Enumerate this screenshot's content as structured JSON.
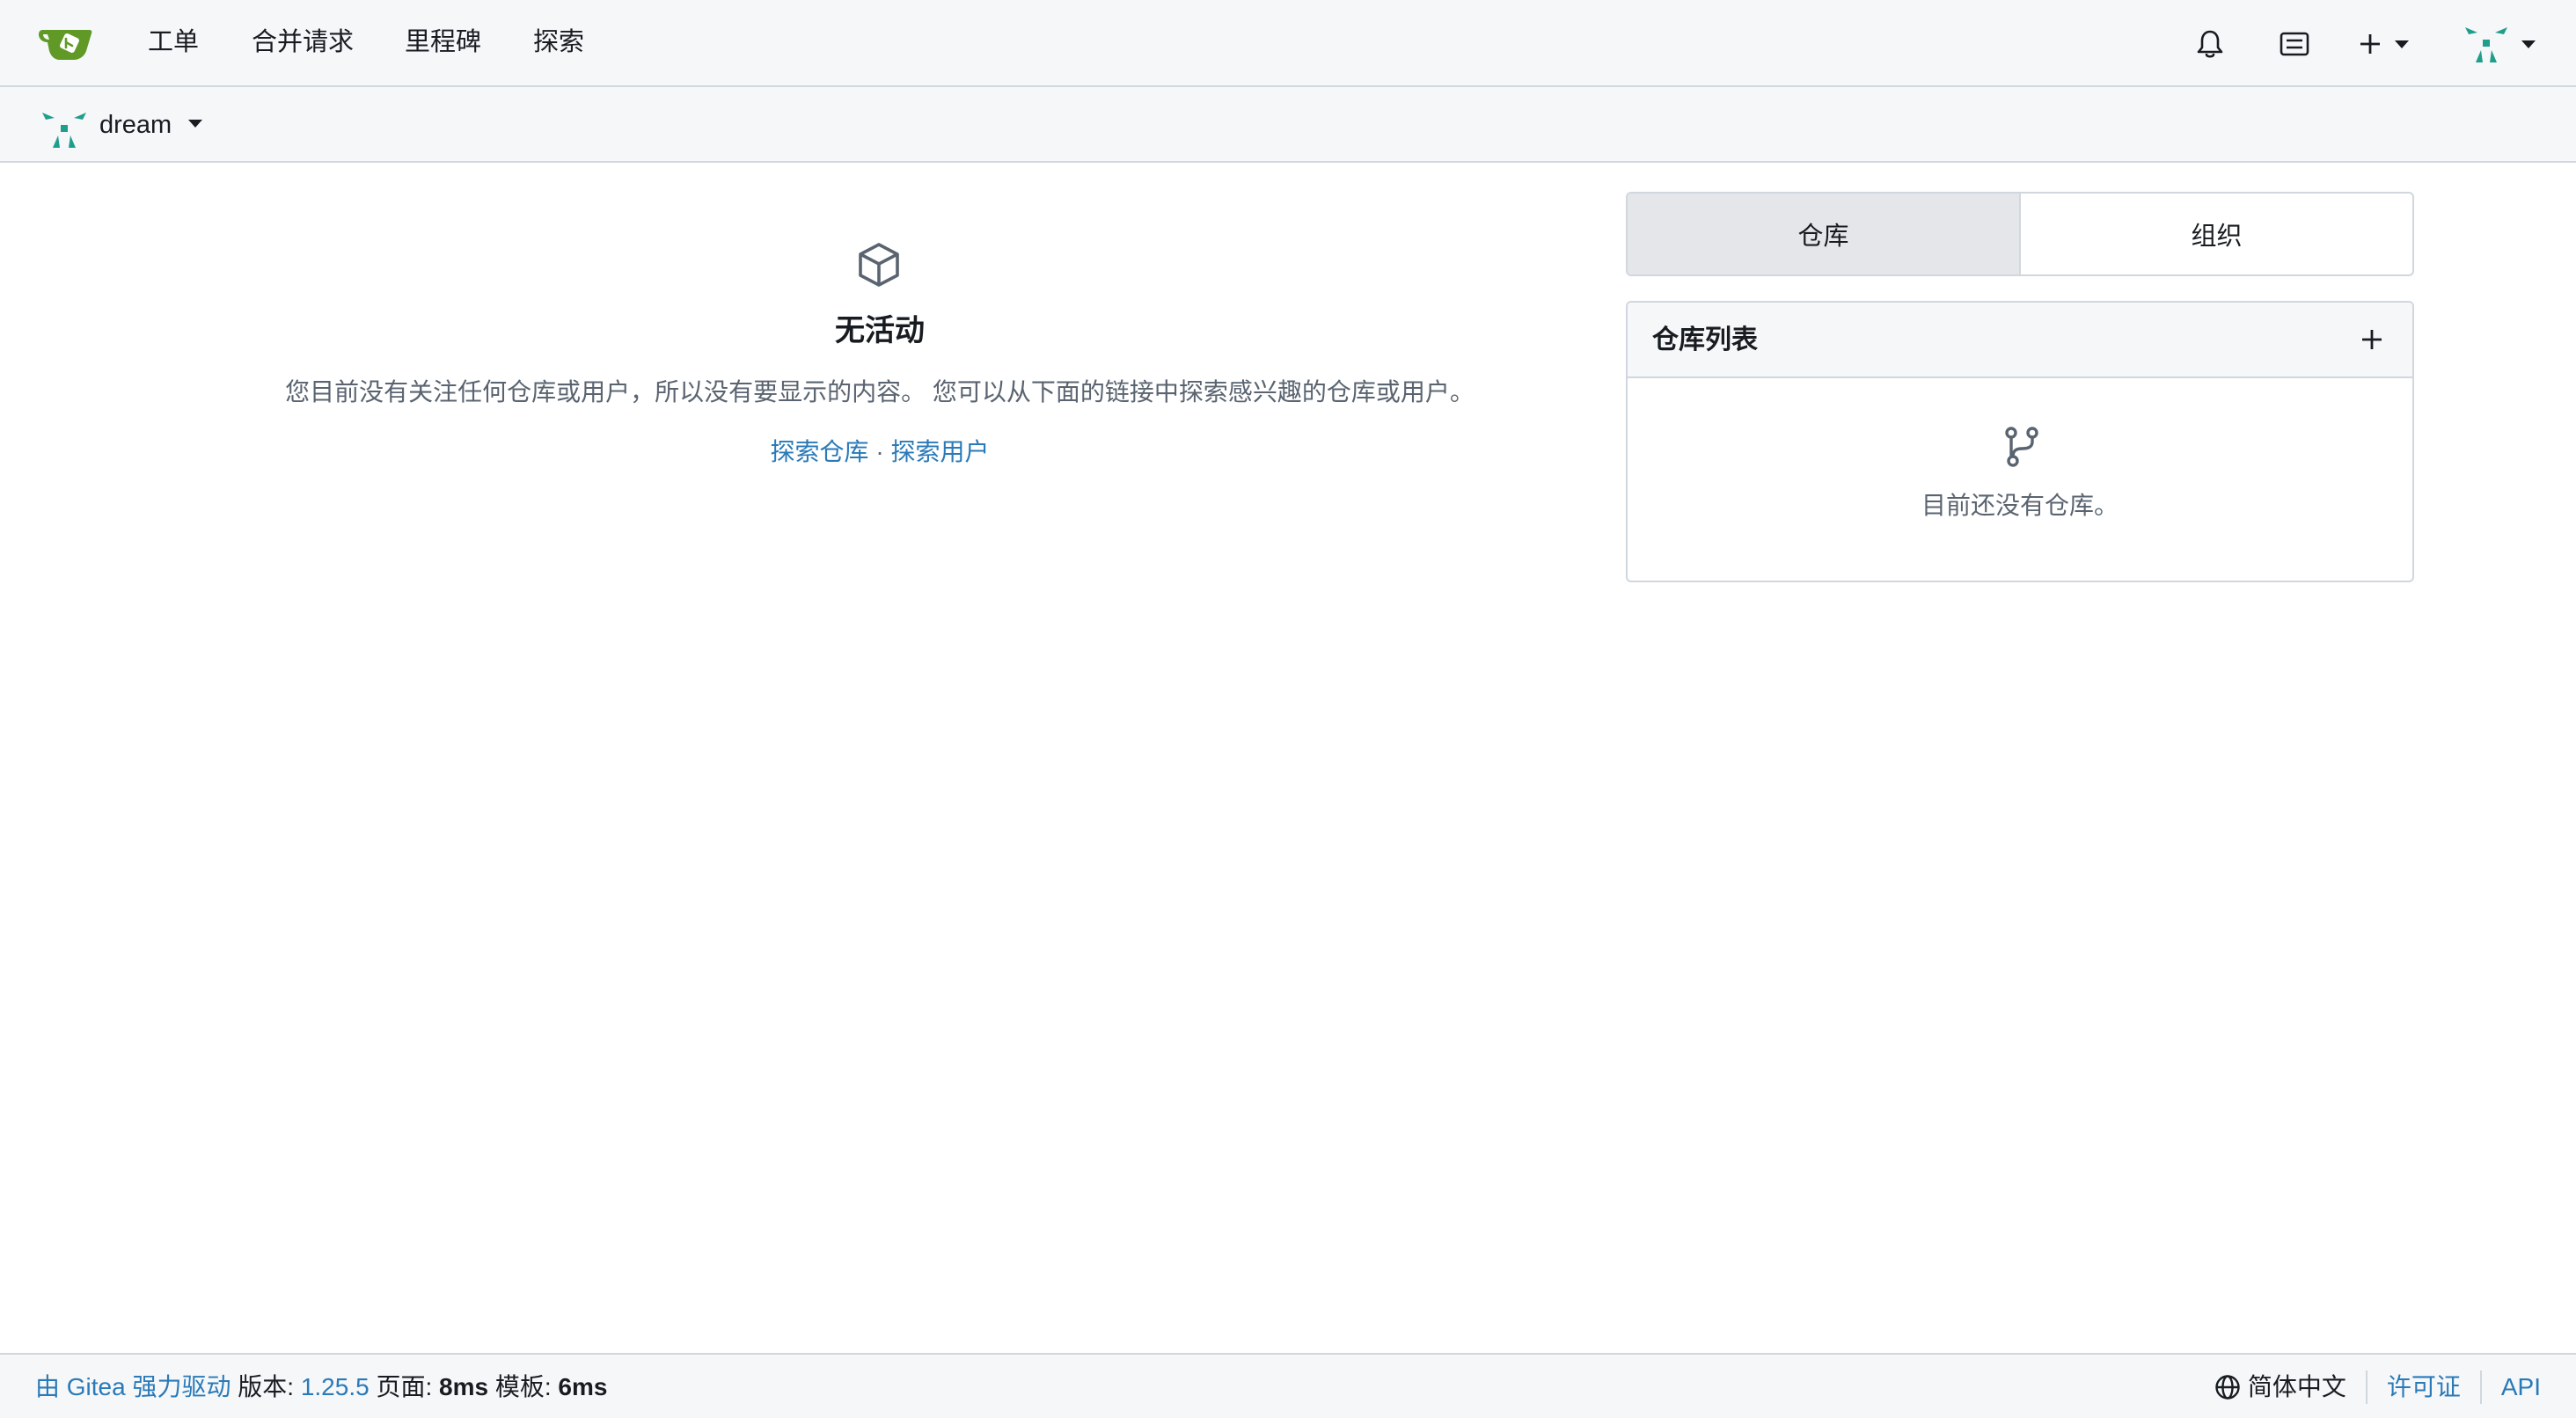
{
  "navbar": {
    "logo": "gitea-logo",
    "items": [
      {
        "label": "工单"
      },
      {
        "label": "合并请求"
      },
      {
        "label": "里程碑"
      },
      {
        "label": "探索"
      }
    ],
    "right_icons": [
      "bell-icon",
      "notification-list-icon",
      "plus-icon",
      "user-avatar"
    ]
  },
  "context": {
    "username": "dream"
  },
  "feed": {
    "title": "无活动",
    "description": "您目前没有关注任何仓库或用户，所以没有要显示的内容。 您可以从下面的链接中探索感兴趣的仓库或用户。",
    "explore_repos": "探索仓库",
    "separator": "·",
    "explore_users": "探索用户"
  },
  "sidebar": {
    "tabs": [
      {
        "label": "仓库",
        "active": true
      },
      {
        "label": "组织",
        "active": false
      }
    ],
    "repo_list": {
      "title": "仓库列表",
      "empty_text": "目前还没有仓库。"
    }
  },
  "footer": {
    "powered_by": "由 Gitea 强力驱动",
    "version_label": "版本:",
    "version": "1.25.5",
    "page_label": "页面:",
    "page_time": "8ms",
    "template_label": "模板:",
    "template_time": "6ms",
    "language": "简体中文",
    "license": "许可证",
    "api": "API"
  },
  "colors": {
    "accent_link": "#2a7ab8",
    "logo_green": "#609926",
    "avatar_teal": "#1f9e8c"
  }
}
